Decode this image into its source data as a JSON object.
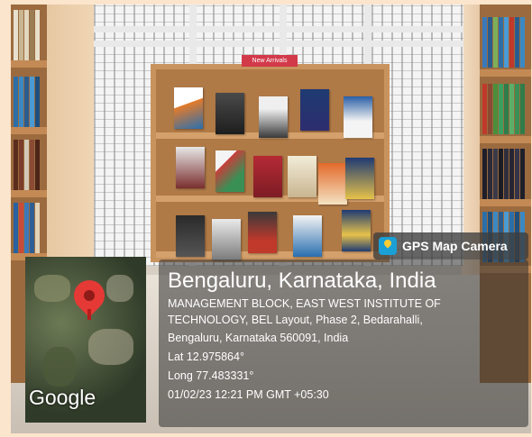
{
  "scene": {
    "sign_text": "New Arrivals"
  },
  "overlay": {
    "app_name": "GPS Map Camera",
    "app_icon": "map-pin-icon",
    "location_title": "Bengaluru, Karnataka, India",
    "address_line_1": "MANAGEMENT BLOCK, EAST WEST INSTITUTE OF",
    "address_line_2": "TECHNOLOGY, BEL Layout, Phase 2, Bedarahalli,",
    "address_line_3": "Bengaluru, Karnataka 560091, India",
    "latitude": "Lat 12.975864°",
    "longitude": "Long 77.483331°",
    "timestamp": "01/02/23 12:21 PM GMT +05:30"
  },
  "map": {
    "provider_label": "Google",
    "pin_icon": "location-pin-icon"
  },
  "colors": {
    "page_border": "#fbe5cc",
    "pin": "#e53935",
    "badge_icon": "#1a9fd6"
  }
}
